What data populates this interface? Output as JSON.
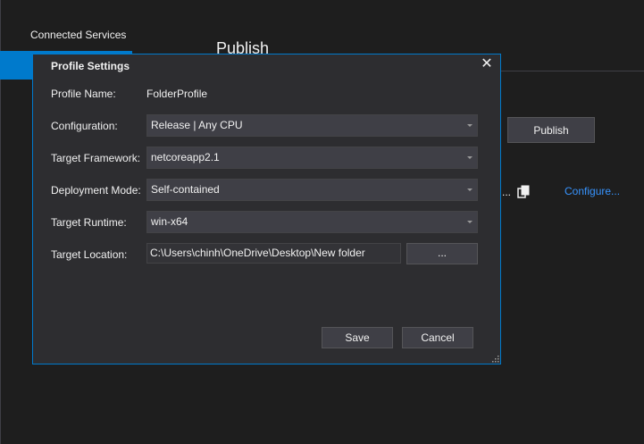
{
  "background": {
    "sidebar_tab": "Connected Services",
    "page_title": "Publish",
    "publish_button": "Publish",
    "ellipsis": "...",
    "configure_link": "Configure..."
  },
  "dialog": {
    "title": "Profile Settings",
    "close_glyph": "✕",
    "profile_name_label": "Profile Name:",
    "profile_name_value": "FolderProfile",
    "configuration_label": "Configuration:",
    "configuration_value": "Release | Any CPU",
    "framework_label": "Target Framework:",
    "framework_value": "netcoreapp2.1",
    "deployment_label": "Deployment Mode:",
    "deployment_value": "Self-contained",
    "runtime_label": "Target Runtime:",
    "runtime_value": "win-x64",
    "location_label": "Target Location:",
    "location_value": "C:\\Users\\chinh\\OneDrive\\Desktop\\New folder",
    "browse_button": "...",
    "save_button": "Save",
    "cancel_button": "Cancel"
  },
  "colors": {
    "accent": "#007acc",
    "link": "#3794ff",
    "dialog_bg": "#2d2d30",
    "window_bg": "#1e1e1e"
  },
  "icons": [
    "copy-icon",
    "close-icon",
    "dropdown-arrow-icon",
    "resize-grip-icon"
  ]
}
